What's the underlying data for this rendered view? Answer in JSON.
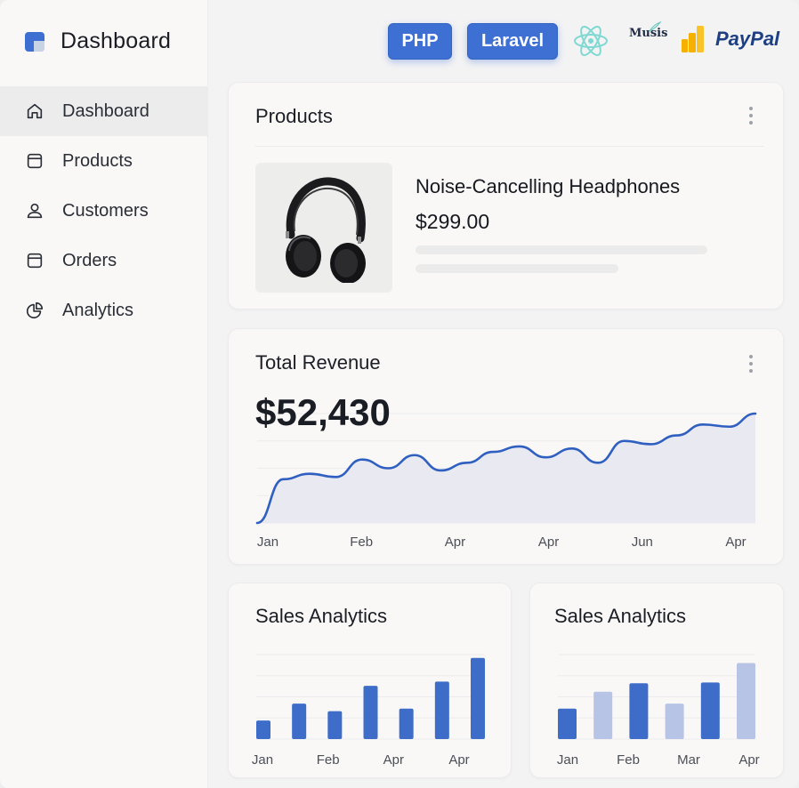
{
  "sidebar": {
    "brand": "Dashboard",
    "items": [
      {
        "label": "Dashboard",
        "icon": "home-icon",
        "active": true
      },
      {
        "label": "Products",
        "icon": "box-icon",
        "active": false
      },
      {
        "label": "Customers",
        "icon": "user-icon",
        "active": false
      },
      {
        "label": "Orders",
        "icon": "box-icon",
        "active": false
      },
      {
        "label": "Analytics",
        "icon": "pie-chart-icon",
        "active": false
      }
    ]
  },
  "header": {
    "badges": [
      "PHP",
      "Laravel"
    ],
    "logos": {
      "react": "react-logo",
      "musis": "Musis",
      "paypal": "PayPal"
    }
  },
  "colors": {
    "accent": "#3e70d3",
    "bar_dark": "#3d6cc9",
    "bar_light": "#b7c4e6",
    "line": "#2f5fc0"
  },
  "products": {
    "title": "Products",
    "item": {
      "name": "Noise-Cancelling Headphones",
      "price": "$299.00",
      "image": "headphones-image"
    }
  },
  "revenue": {
    "title": "Total Revenue",
    "value": "$52,430"
  },
  "sales1": {
    "title": "Sales Analytics"
  },
  "sales2": {
    "title": "Sales Analytics"
  },
  "chart_data": [
    {
      "type": "area",
      "title": "Total Revenue",
      "x_tick_labels": [
        "Jan",
        "Feb",
        "Apr",
        "Apr",
        "Jun",
        "Apr"
      ],
      "values": [
        0,
        40,
        45,
        42,
        58,
        50,
        62,
        48,
        55,
        65,
        70,
        60,
        68,
        55,
        75,
        72,
        80,
        90,
        88,
        100
      ],
      "ylim": [
        0,
        100
      ],
      "grid": true
    },
    {
      "type": "bar",
      "title": "Sales Analytics",
      "x_tick_labels": [
        "Jan",
        "Feb",
        "Apr",
        "Apr"
      ],
      "values": [
        22,
        42,
        33,
        63,
        36,
        68,
        96
      ],
      "ylim": [
        0,
        100
      ],
      "grid": true
    },
    {
      "type": "bar",
      "title": "Sales Analytics",
      "x_tick_labels": [
        "Jan",
        "Feb",
        "Mar",
        "Apr"
      ],
      "values": [
        36,
        56,
        66,
        42,
        67,
        90
      ],
      "highlight": [
        true,
        false,
        true,
        false,
        true,
        false
      ],
      "ylim": [
        0,
        100
      ],
      "grid": true
    }
  ]
}
